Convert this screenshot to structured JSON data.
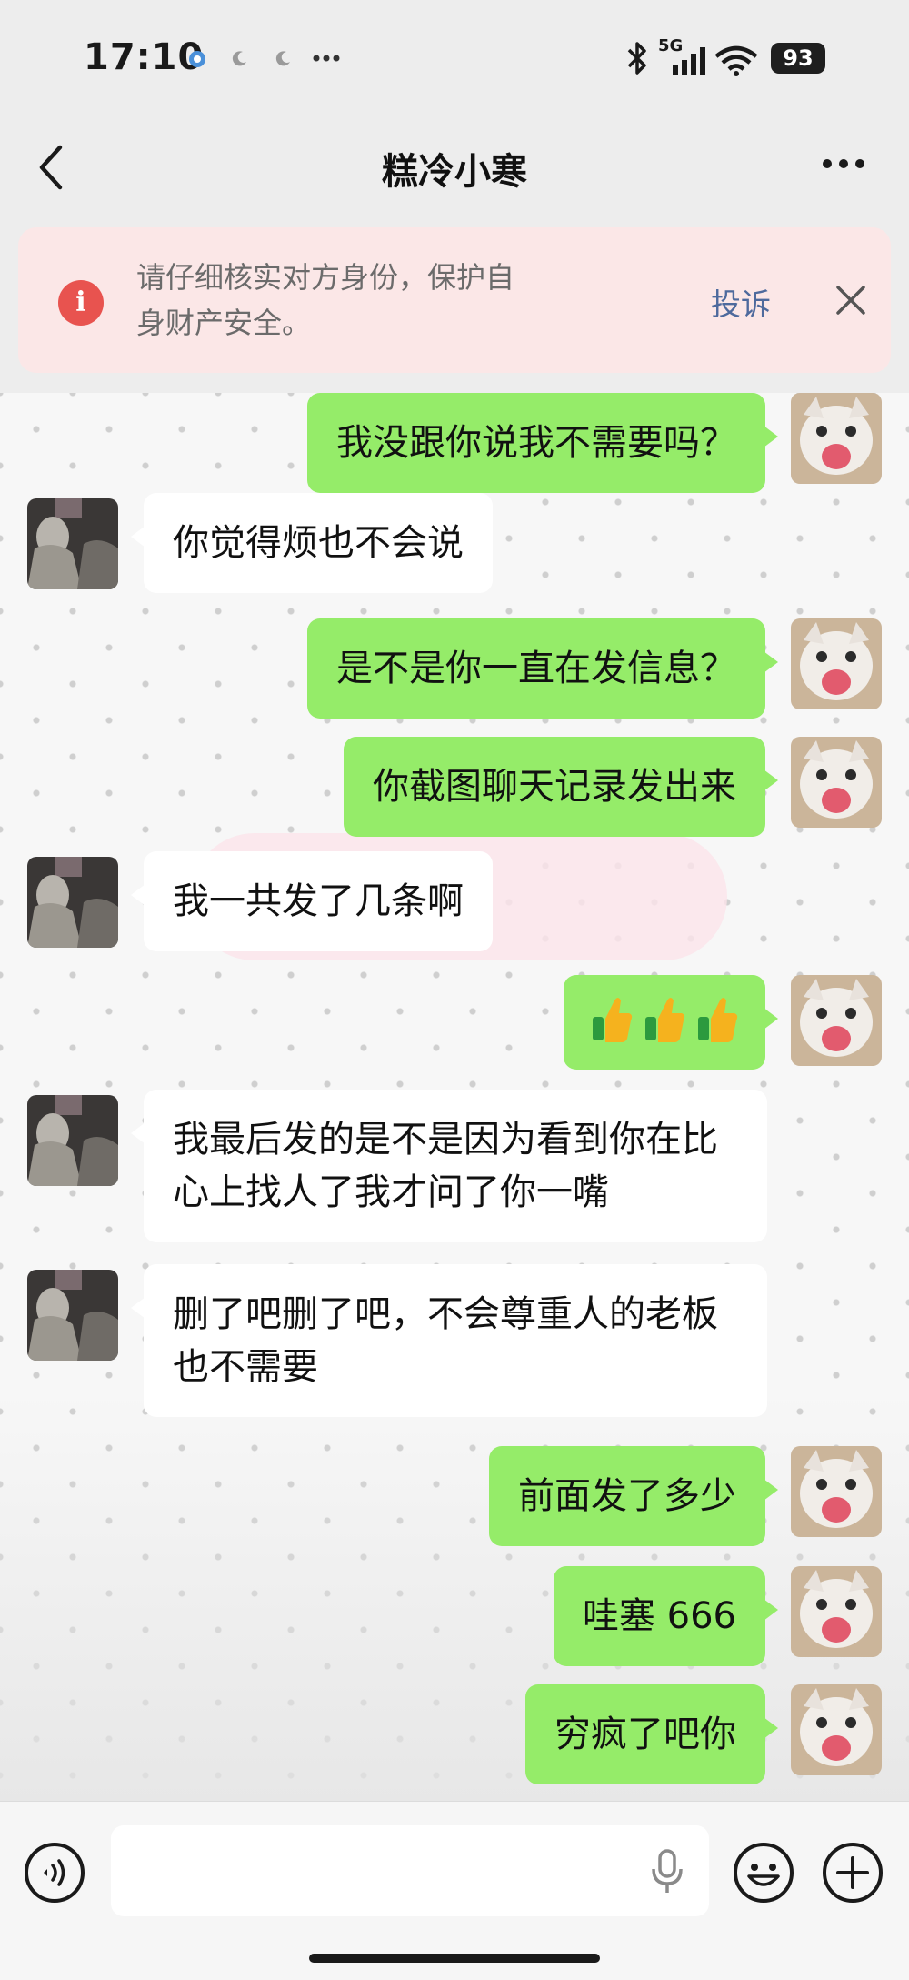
{
  "status_bar": {
    "time": "17:10",
    "network": "5G",
    "battery": "93",
    "icons": [
      "notification-icon",
      "moon-icon",
      "moon-icon",
      "more-dots-icon",
      "bluetooth-icon",
      "signal-icon",
      "wifi-icon",
      "battery-icon"
    ]
  },
  "header": {
    "title": "糕冷小寒",
    "back_icon": "chevron-left-icon",
    "more_icon": "more-horizontal-icon"
  },
  "banner": {
    "text": "请仔细核实对方身份，保护自身财产安全。",
    "report_label": "投诉",
    "icons": [
      "warning-icon",
      "close-icon"
    ],
    "background": "#fbe7e7",
    "link_color": "#4e6a9d"
  },
  "messages": [
    {
      "sender": "me",
      "text": "我没跟你说我不需要吗？"
    },
    {
      "sender": "them",
      "text": "你觉得烦也不会说"
    },
    {
      "sender": "me",
      "text": "是不是你一直在发信息？"
    },
    {
      "sender": "me",
      "text": "你截图聊天记录发出来"
    },
    {
      "sender": "them",
      "text": "我一共发了几条啊"
    },
    {
      "sender": "me",
      "text": "",
      "emoji": "thumbs-up x3"
    },
    {
      "sender": "them",
      "text": "我最后发的是不是因为看到你在比心上找人了我才问了你一嘴"
    },
    {
      "sender": "them",
      "text": "删了吧删了吧，不会尊重人的老板也不需要"
    },
    {
      "sender": "me",
      "text": "前面发了多少"
    },
    {
      "sender": "me",
      "text": "哇塞 666"
    },
    {
      "sender": "me",
      "text": "穷疯了吧你"
    }
  ],
  "colors": {
    "my_bubble": "#95ec69",
    "their_bubble": "#ffffff",
    "background": "#ededed"
  },
  "input_bar": {
    "placeholder": "",
    "icons": [
      "voice-icon",
      "microphone-icon",
      "emoji-icon",
      "plus-icon"
    ]
  }
}
